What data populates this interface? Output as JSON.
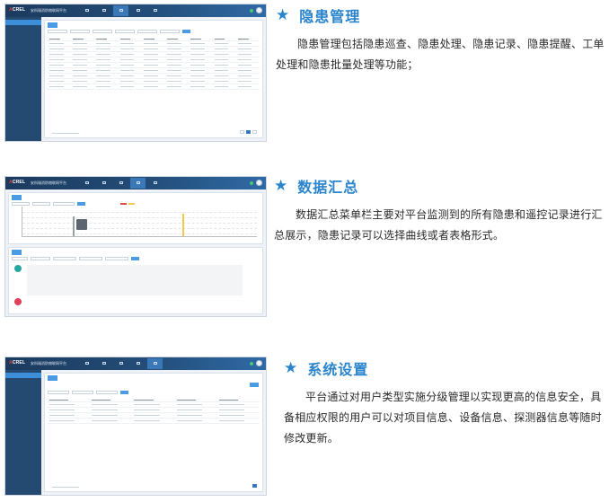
{
  "screenshot": {
    "logo_prefix": "A",
    "logo_main": "CREL",
    "app_name": "安科瑞消防物联网平台"
  },
  "sections": [
    {
      "title": "隐患管理",
      "body": "隐患管理包括隐患巡查、隐患处理、隐患记录、隐患提醒、工单处理和隐患批量处理等功能；"
    },
    {
      "title": "数据汇总",
      "body": "数据汇总菜单栏主要对平台监测到的所有隐患和遥控记录进行汇总展示，隐患记录可以选择曲线或者表格形式。"
    },
    {
      "title": "系统设置",
      "body": "平台通过对用户类型实施分级管理以实现更高的信息安全，具备相应权限的用户可以对项目信息、设备信息、探测器信息等随时修改更新。"
    }
  ],
  "colors": {
    "accent": "#2a84cc",
    "header": "#1c3a5e",
    "sidebar": "#254a71",
    "active": "#3d8ed8",
    "legend_red": "#e04a4a",
    "legend_yellow": "#f2c94c"
  },
  "icons": {
    "star": "★"
  }
}
